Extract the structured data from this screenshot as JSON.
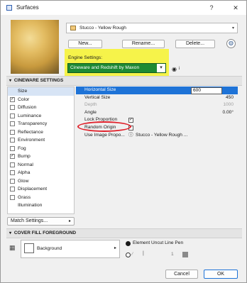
{
  "window": {
    "title": "Surfaces",
    "help": "?",
    "close": "✕"
  },
  "material": {
    "name": "Stucco - Yellow Rough",
    "swatch_color": "#f2c97a"
  },
  "buttons": {
    "new": "New...",
    "rename": "Rename...",
    "delete": "Delete..."
  },
  "engine": {
    "label": "Engine Settings:",
    "value": "Cineware and Redshift by Maxon"
  },
  "cineware_header": "CINEWARE SETTINGS",
  "channels": [
    {
      "label": "Size",
      "checkbox": false,
      "checked": false,
      "selected": true
    },
    {
      "label": "Color",
      "checkbox": true,
      "checked": true,
      "selected": false
    },
    {
      "label": "Diffusion",
      "checkbox": true,
      "checked": false,
      "selected": false
    },
    {
      "label": "Luminance",
      "checkbox": true,
      "checked": false,
      "selected": false
    },
    {
      "label": "Transparency",
      "checkbox": true,
      "checked": false,
      "selected": false
    },
    {
      "label": "Reflectance",
      "checkbox": true,
      "checked": false,
      "selected": false
    },
    {
      "label": "Environment",
      "checkbox": true,
      "checked": false,
      "selected": false
    },
    {
      "label": "Fog",
      "checkbox": true,
      "checked": false,
      "selected": false
    },
    {
      "label": "Bump",
      "checkbox": true,
      "checked": true,
      "selected": false
    },
    {
      "label": "Normal",
      "checkbox": true,
      "checked": false,
      "selected": false
    },
    {
      "label": "Alpha",
      "checkbox": true,
      "checked": false,
      "selected": false
    },
    {
      "label": "Glow",
      "checkbox": true,
      "checked": false,
      "selected": false
    },
    {
      "label": "Displacement",
      "checkbox": true,
      "checked": false,
      "selected": false
    },
    {
      "label": "Grass",
      "checkbox": true,
      "checked": false,
      "selected": false
    },
    {
      "label": "Illumination",
      "checkbox": false,
      "checked": false,
      "selected": false
    }
  ],
  "match_settings": "Match Settings...",
  "properties": {
    "horizontal_size": {
      "label": "Horizontal Size",
      "value": "600"
    },
    "vertical_size": {
      "label": "Vertical Size",
      "value": "450"
    },
    "depth": {
      "label": "Depth",
      "value": "1000"
    },
    "angle": {
      "label": "Angle",
      "value": "0.00°"
    },
    "lock_proportion": {
      "label": "Lock Proportion",
      "checked": true
    },
    "random_origin": {
      "label": "Random Origin",
      "checked": false
    },
    "use_image_proportion": {
      "label": "Use Image Propo...",
      "value": "Stucco - Yellow Rough ..."
    }
  },
  "cover_fill": {
    "header": "COVER FILL FOREGROUND",
    "background_label": "Background",
    "radio_uncut": "Element Uncut Line Pen",
    "pen_value": "1"
  },
  "footer": {
    "cancel": "Cancel",
    "ok": "OK"
  }
}
